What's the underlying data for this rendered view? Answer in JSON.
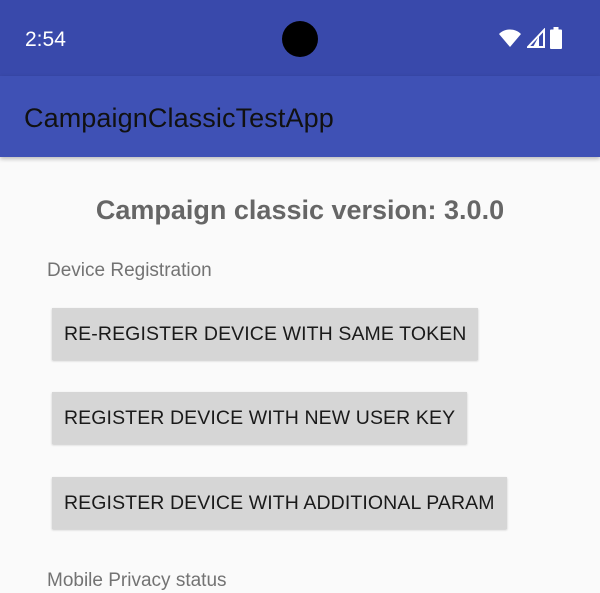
{
  "status_bar": {
    "time": "2:54",
    "icons": [
      "wifi-icon",
      "cell-signal-icon",
      "battery-icon"
    ]
  },
  "app_bar": {
    "title": "CampaignClassicTestApp"
  },
  "main": {
    "version_text": "Campaign classic version: 3.0.0",
    "device_registration_label": "Device Registration",
    "buttons": [
      {
        "label": "RE-REGISTER DEVICE WITH SAME TOKEN"
      },
      {
        "label": "REGISTER DEVICE WITH NEW USER KEY"
      },
      {
        "label": "REGISTER DEVICE WITH ADDITIONAL PARAM"
      }
    ],
    "privacy_label": "Mobile Privacy status"
  },
  "colors": {
    "status_bar": "#3949ab",
    "app_bar": "#3f51b5",
    "background": "#fafafa",
    "button": "#d6d6d6"
  }
}
